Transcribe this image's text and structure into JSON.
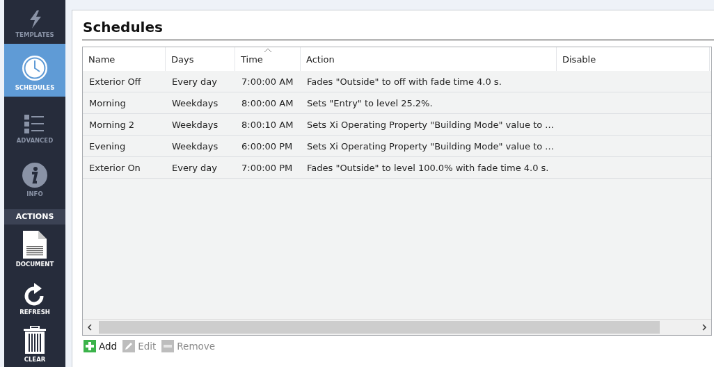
{
  "sidebar": {
    "items": [
      {
        "label": "TEMPLATES",
        "kind": "bolt",
        "selected": false
      },
      {
        "label": "SCHEDULES",
        "kind": "clock",
        "selected": true
      },
      {
        "label": "ADVANCED",
        "kind": "list",
        "selected": false
      },
      {
        "label": "INFO",
        "kind": "info",
        "selected": false
      }
    ],
    "actions_heading": "ACTIONS",
    "actions": [
      {
        "label": "DOCUMENT",
        "kind": "document"
      },
      {
        "label": "REFRESH",
        "kind": "refresh"
      },
      {
        "label": "CLEAR",
        "kind": "trash"
      }
    ]
  },
  "panel": {
    "title": "Schedules"
  },
  "table": {
    "columns": [
      {
        "label": "Name",
        "sorted": false
      },
      {
        "label": "Days",
        "sorted": false
      },
      {
        "label": "Time",
        "sorted": true
      },
      {
        "label": "Action",
        "sorted": false
      },
      {
        "label": "Disable",
        "sorted": false
      }
    ],
    "rows": [
      [
        "Exterior Off",
        "Every day",
        "7:00:00 AM",
        "Fades \"Outside\" to off with fade time 4.0 s."
      ],
      [
        "Morning",
        "Weekdays",
        "8:00:00 AM",
        "Sets \"Entry\" to level 25.2%."
      ],
      [
        "Morning 2",
        "Weekdays",
        "8:00:10 AM",
        "Sets Xi Operating Property \"Building Mode\" value to ..."
      ],
      [
        "Evening",
        "Weekdays",
        "6:00:00 PM",
        "Sets Xi Operating Property \"Building Mode\" value to ..."
      ],
      [
        "Exterior On",
        "Every day",
        "7:00:00 PM",
        "Fades \"Outside\" to level 100.0% with fade time 4.0 s."
      ]
    ]
  },
  "buttons": [
    {
      "label": "Add",
      "kind": "add",
      "disabled": false
    },
    {
      "label": "Edit",
      "kind": "edit",
      "disabled": true
    },
    {
      "label": "Remove",
      "kind": "remove",
      "disabled": true
    }
  ]
}
